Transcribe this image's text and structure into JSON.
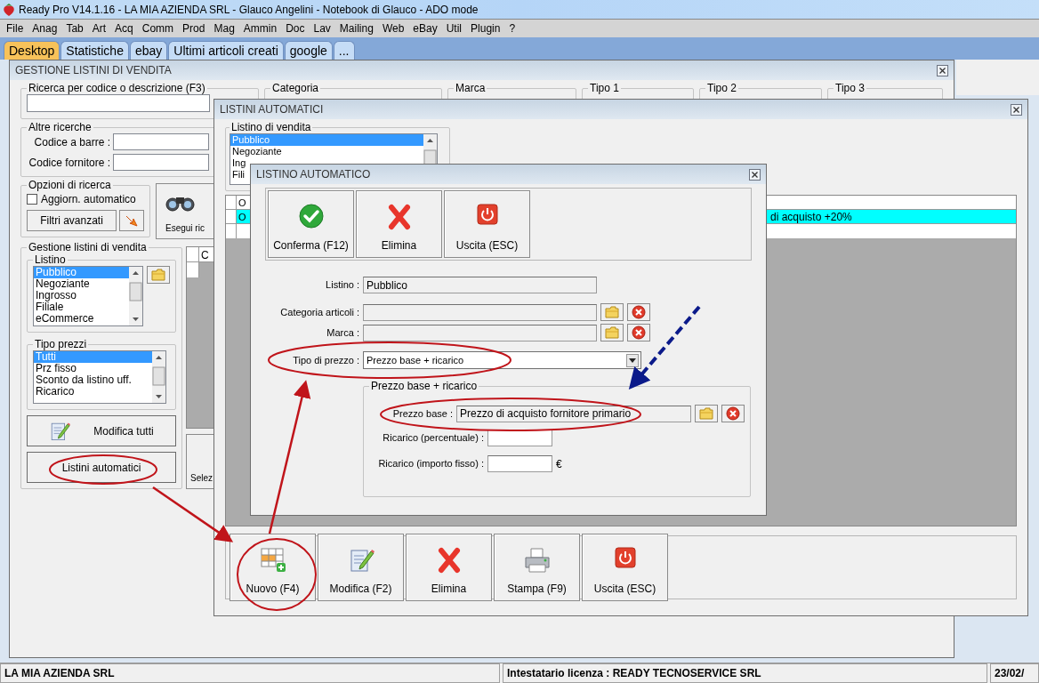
{
  "window": {
    "title": "Ready Pro V14.1.16 - LA MIA AZIENDA SRL - Glauco Angelini - Notebook di Glauco - ADO mode"
  },
  "menu": [
    "File",
    "Anag",
    "Tab",
    "Art",
    "Acq",
    "Comm",
    "Prod",
    "Mag",
    "Ammin",
    "Doc",
    "Lav",
    "Mailing",
    "Web",
    "eBay",
    "Util",
    "Plugin",
    "?"
  ],
  "tabs": [
    {
      "label": "Desktop",
      "selected": true
    },
    {
      "label": "Statistiche",
      "selected": false
    },
    {
      "label": "ebay",
      "selected": false
    },
    {
      "label": "Ultimi articoli creati",
      "selected": false
    },
    {
      "label": "google",
      "selected": false
    },
    {
      "label": "...",
      "selected": false
    }
  ],
  "gestione": {
    "title": "GESTIONE LISTINI DI VENDITA",
    "search_group": {
      "label": "Ricerca per codice o descrizione (F3)"
    },
    "filter_groups": [
      "Categoria",
      "Marca",
      "Tipo 1",
      "Tipo 2",
      "Tipo 3"
    ],
    "altre_ricerche": {
      "label": "Altre ricerche",
      "fields": [
        "Codice a barre :",
        "Codice fornitore :"
      ]
    },
    "opzioni": {
      "label": "Opzioni di ricerca",
      "checkbox": {
        "label": "Aggiorn. automatico",
        "checked": false
      },
      "button": "Filtri avanzati"
    },
    "search_button": "Esegui ric",
    "listini_group": {
      "label": "Gestione listini di vendita",
      "listino": {
        "label": "Listino",
        "items": [
          {
            "label": "Pubblico",
            "selected": true
          },
          {
            "label": "Negoziante",
            "selected": false
          },
          {
            "label": "Ingrosso",
            "selected": false
          },
          {
            "label": "Filiale",
            "selected": false
          },
          {
            "label": "eCommerce",
            "selected": false
          }
        ]
      },
      "tipo_prezzi": {
        "label": "Tipo prezzi",
        "items": [
          {
            "label": "Tutti",
            "selected": true
          },
          {
            "label": "Prz fisso",
            "selected": false
          },
          {
            "label": "Sconto da listino uff.",
            "selected": false
          },
          {
            "label": "Ricarico",
            "selected": false
          }
        ]
      },
      "buttons": [
        {
          "label": "Modifica tutti",
          "kind": "edit"
        },
        {
          "label": "Listini automatici",
          "kind": "plain"
        }
      ]
    },
    "grid": {
      "column_1": "C"
    },
    "select_button": "Selez"
  },
  "listini_automatici": {
    "title": "LISTINI AUTOMATICI",
    "listino_group": {
      "label": "Listino di vendita",
      "items": [
        {
          "label": "Pubblico",
          "selected": true
        },
        {
          "label": "Negoziante",
          "selected": false
        },
        {
          "label": "Ing",
          "selected": false
        },
        {
          "label": "Fili",
          "selected": false
        }
      ]
    },
    "table": {
      "column_1": "O",
      "rows": [
        {
          "cells": [
            "O",
            "di acquisto +20%"
          ],
          "selected": true
        }
      ]
    },
    "toolbar": [
      {
        "label": "Nuovo (F4)",
        "kind": "new"
      },
      {
        "label": "Modifica (F2)",
        "kind": "edit"
      },
      {
        "label": "Elimina",
        "kind": "delete"
      },
      {
        "label": "Stampa (F9)",
        "kind": "print"
      },
      {
        "label": "Uscita (ESC)",
        "kind": "exit"
      }
    ]
  },
  "listino_automatico": {
    "title": "LISTINO AUTOMATICO",
    "toolbar": [
      {
        "label": "Conferma (F12)",
        "kind": "confirm"
      },
      {
        "label": "Elimina",
        "kind": "delete"
      },
      {
        "label": "Uscita (ESC)",
        "kind": "exit"
      }
    ],
    "listino": {
      "label": "Listino :",
      "value": "Pubblico"
    },
    "categoria": {
      "label": "Categoria articoli :"
    },
    "marca": {
      "label": "Marca :"
    },
    "tipo_prezzo": {
      "label": "Tipo di prezzo :",
      "value": "Prezzo base + ricarico"
    },
    "group": {
      "label": "Prezzo base + ricarico",
      "prezzo_base": {
        "label": "Prezzo base :",
        "value": "Prezzo di acquisto fornitore primario"
      },
      "ricarico_percentuale": {
        "label": "Ricarico (percentuale) :"
      },
      "ricarico_fisso": {
        "label": "Ricarico (importo fisso) :",
        "unit": "€"
      }
    }
  },
  "status_bar": [
    "LA MIA AZIENDA SRL",
    "Intestatario licenza : READY TECNOSERVICE SRL",
    "23/02/"
  ]
}
